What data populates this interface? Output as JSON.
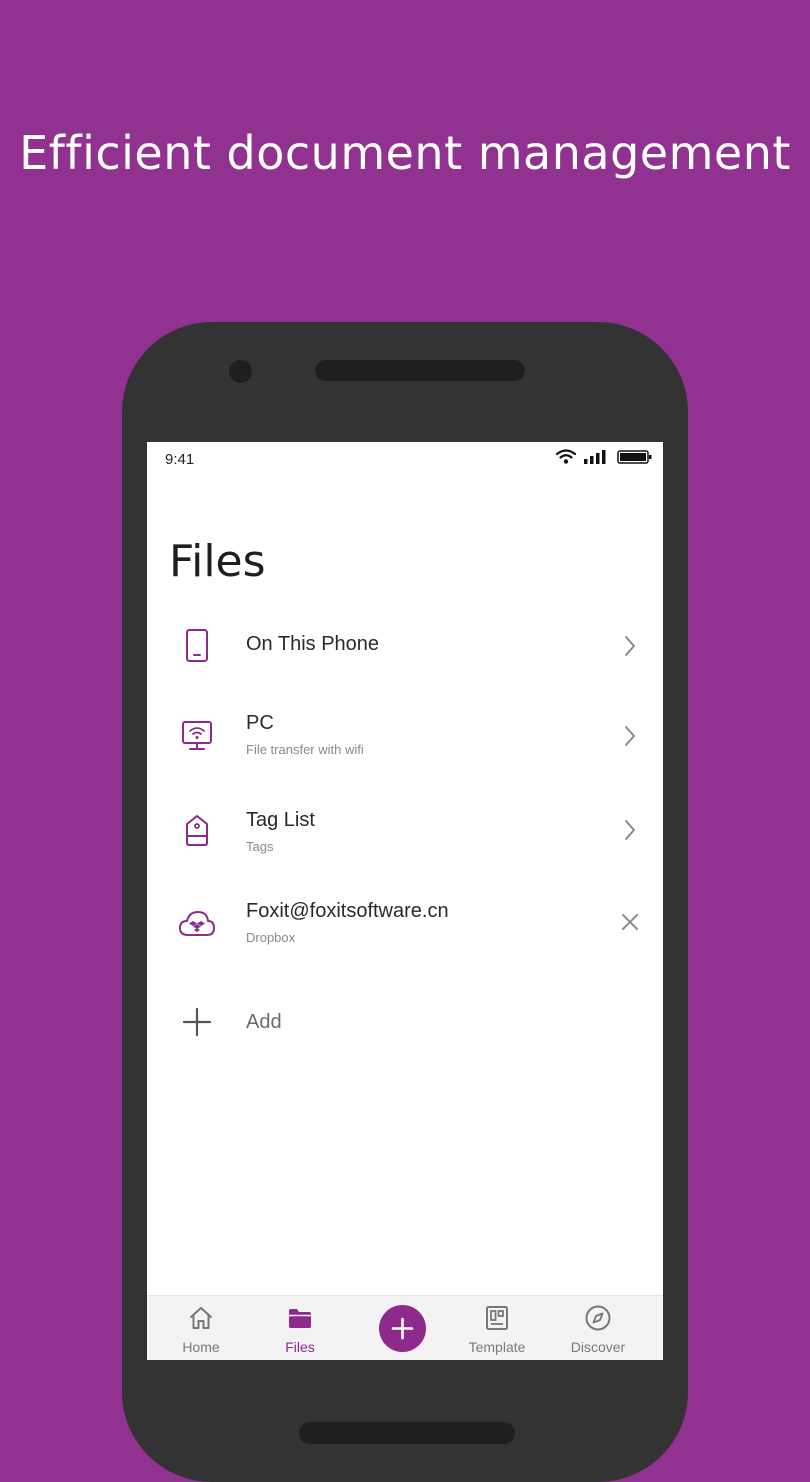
{
  "headline": "Efficient document management",
  "status_bar": {
    "time": "9:41",
    "icons": [
      "wifi-icon",
      "signal-icon",
      "battery-icon"
    ]
  },
  "page": {
    "title": "Files"
  },
  "files_list": [
    {
      "icon": "phone-icon",
      "title": "On This Phone",
      "subtitle": "",
      "action": "chevron-right-icon"
    },
    {
      "icon": "monitor-wifi-icon",
      "title": "PC",
      "subtitle": "File transfer with wifi",
      "action": "chevron-right-icon"
    },
    {
      "icon": "tag-icon",
      "title": "Tag List",
      "subtitle": "Tags",
      "action": "chevron-right-icon"
    },
    {
      "icon": "dropbox-cloud-icon",
      "title": "Foxit@foxitsoftware.cn",
      "subtitle": "Dropbox",
      "action": "close-icon"
    },
    {
      "icon": "plus-icon",
      "title": "Add",
      "subtitle": "",
      "action": ""
    }
  ],
  "bottom_nav": {
    "items": [
      {
        "label": "Home",
        "icon": "home-icon",
        "active": false
      },
      {
        "label": "Files",
        "icon": "folder-icon",
        "active": true
      },
      {
        "label": "Template",
        "icon": "template-icon",
        "active": false
      },
      {
        "label": "Discover",
        "icon": "compass-icon",
        "active": false
      }
    ],
    "fab_icon": "plus-icon"
  },
  "colors": {
    "background": "#913190",
    "accent": "#8d2a8c",
    "phone_frame": "#333333",
    "nav_background": "#f3f3f3"
  }
}
